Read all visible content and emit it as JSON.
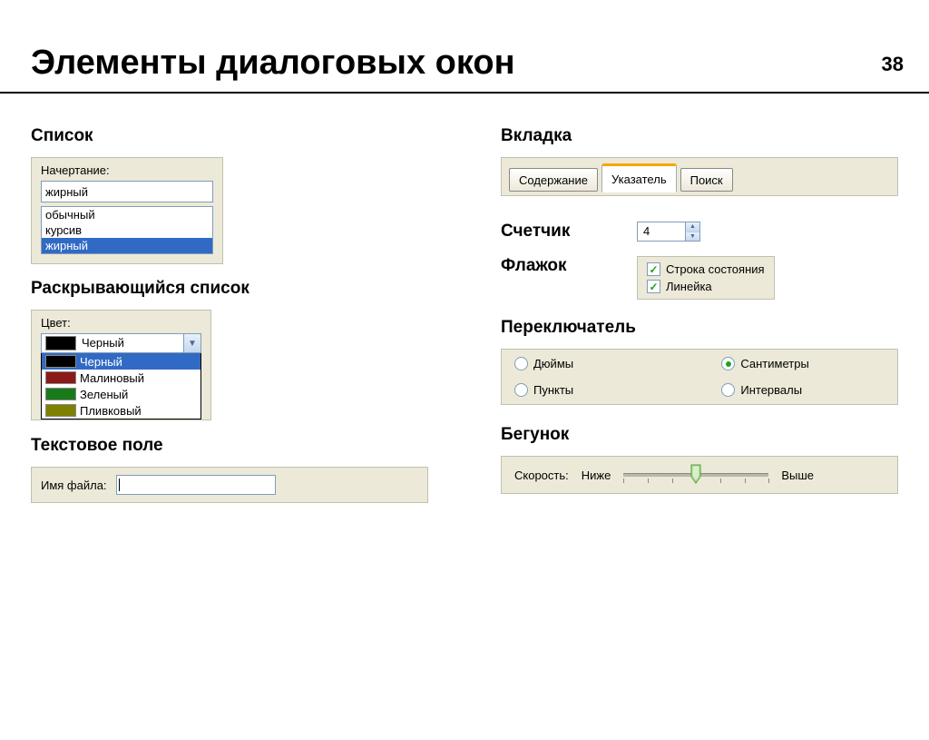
{
  "page_number": "38",
  "title": "Элементы диалоговых окон",
  "left": {
    "list": {
      "label": "Список",
      "field_label": "Начертание:",
      "value": "жирный",
      "options": [
        "обычный",
        "курсив",
        "жирный"
      ],
      "selected_index": 2
    },
    "dropdown": {
      "label": "Раскрывающийся список",
      "field_label": "Цвет:",
      "value": "Черный",
      "options": [
        {
          "name": "Черный",
          "color": "#000000"
        },
        {
          "name": "Малиновый",
          "color": "#8b1a1a"
        },
        {
          "name": "Зеленый",
          "color": "#1a7a1a"
        },
        {
          "name": "Пливковый",
          "color": "#808000"
        }
      ],
      "selected_index": 0
    },
    "textfield": {
      "label": "Текстовое поле",
      "field_label": "Имя файла:",
      "value": ""
    }
  },
  "right": {
    "tabs": {
      "label": "Вкладка",
      "items": [
        "Содержание",
        "Указатель",
        "Поиск"
      ],
      "active_index": 1
    },
    "spinner": {
      "label": "Счетчик",
      "value": "4"
    },
    "checkbox": {
      "label": "Флажок",
      "items": [
        {
          "text": "Строка состояния",
          "checked": true
        },
        {
          "text": "Линейка",
          "checked": true
        }
      ]
    },
    "radio": {
      "label": "Переключатель",
      "items": [
        {
          "text": "Дюймы",
          "checked": false
        },
        {
          "text": "Сантиметры",
          "checked": true
        },
        {
          "text": "Пункты",
          "checked": false
        },
        {
          "text": "Интервалы",
          "checked": false
        }
      ]
    },
    "slider": {
      "label": "Бегунок",
      "field_label": "Скорость:",
      "min_label": "Ниже",
      "max_label": "Выше",
      "position": 0.5
    }
  }
}
